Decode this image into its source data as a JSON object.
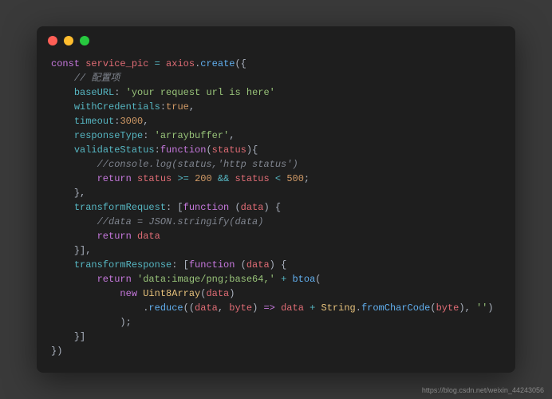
{
  "watermark": "https://blog.csdn.net/weixin_44243056",
  "code": {
    "l1": {
      "kw": "const",
      "var": "service_pic",
      "op": "=",
      "obj": "axios",
      "fn": "create",
      "open": "({"
    },
    "l2": {
      "cmt": "// 配置项"
    },
    "l3": {
      "prop": "baseURL",
      "str": "'your request url is here'"
    },
    "l4": {
      "prop": "withCredentials",
      "bool": "true"
    },
    "l5": {
      "prop": "timeout",
      "num": "3000"
    },
    "l6": {
      "prop": "responseType",
      "str": "'arraybuffer'"
    },
    "l7": {
      "prop": "validateStatus",
      "kw": "function",
      "arg": "status"
    },
    "l8": {
      "cmt": "//console.log(status,'http status')"
    },
    "l9": {
      "kw": "return",
      "var": "status",
      "op1": ">=",
      "num1": "200",
      "op2": "&&",
      "var2": "status",
      "op3": "<",
      "num2": "500"
    },
    "l10": {
      "close": "},"
    },
    "l11": {
      "prop": "transformRequest",
      "kw": "function",
      "arg": "data"
    },
    "l12": {
      "cmt": "//data = JSON.stringify(data)"
    },
    "l13": {
      "kw": "return",
      "var": "data"
    },
    "l14": {
      "close": "}],"
    },
    "l15": {
      "prop": "transformResponse",
      "kw": "function",
      "arg": "data"
    },
    "l16": {
      "kw": "return",
      "str": "'data:image/png;base64,'",
      "op": "+",
      "fn": "btoa"
    },
    "l17": {
      "kw": "new",
      "cls": "Uint8Array",
      "arg": "data"
    },
    "l18": {
      "fn": "reduce",
      "arg1": "data",
      "arg2": "byte",
      "arrow": "=>",
      "var": "data",
      "op": "+",
      "cls": "String",
      "fn2": "fromCharCode",
      "arg3": "byte",
      "str": "''"
    },
    "l19": {
      "close": ");"
    },
    "l20": {
      "close": "}]"
    },
    "l21": {
      "close": "})"
    }
  }
}
